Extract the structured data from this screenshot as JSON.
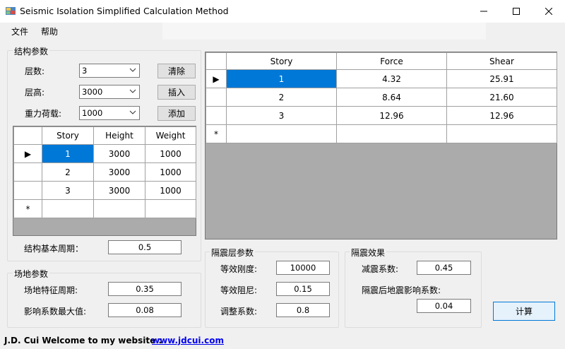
{
  "window": {
    "title": "Seismic Isolation Simplified Calculation Method",
    "controls": {
      "minimize": "—",
      "maximize": "☐",
      "close": "✕"
    }
  },
  "menu": {
    "file": "文件",
    "help": "帮助"
  },
  "structure": {
    "group_title": "结构参数",
    "floors_label": "层数:",
    "floors_value": "3",
    "height_label": "层高:",
    "height_value": "3000",
    "gravity_label": "重力荷载:",
    "gravity_value": "1000",
    "buttons": {
      "clear": "清除",
      "insert": "插入",
      "add": "添加"
    },
    "grid": {
      "headers": [
        "Story",
        "Height",
        "Weight"
      ],
      "rows": [
        [
          "1",
          "3000",
          "1000"
        ],
        [
          "2",
          "3000",
          "1000"
        ],
        [
          "3",
          "3000",
          "1000"
        ]
      ],
      "current_marker": "▶",
      "new_row_marker": "*"
    },
    "period_label": "结构基本周期：",
    "period_value": "0.5"
  },
  "site": {
    "group_title": "场地参数",
    "char_period_label": "场地特征周期:",
    "char_period_value": "0.35",
    "max_coef_label": "影响系数最大值:",
    "max_coef_value": "0.08"
  },
  "results_grid": {
    "headers": [
      "Story",
      "Force",
      "Shear"
    ],
    "rows": [
      [
        "1",
        "4.32",
        "25.91"
      ],
      [
        "2",
        "8.64",
        "21.60"
      ],
      [
        "3",
        "12.96",
        "12.96"
      ]
    ],
    "current_marker": "▶",
    "new_row_marker": "*"
  },
  "isolation_layer": {
    "group_title": "隔震层参数",
    "stiffness_label": "等效刚度:",
    "stiffness_value": "10000",
    "damping_label": "等效阻尼:",
    "damping_value": "0.15",
    "adjust_label": "调整系数:",
    "adjust_value": "0.8"
  },
  "isolation_effect": {
    "group_title": "隔震效果",
    "reduction_label": "减震系数:",
    "reduction_value": "0.45",
    "after_label": "隔震后地震影响系数:",
    "after_value": "0.04"
  },
  "calc_button": "计算",
  "status": {
    "text": "J.D. Cui  Welcome to my website :",
    "link": "www.jdcui.com"
  },
  "colors": {
    "selection": "#0078d7",
    "grid_empty": "#ababab",
    "link": "#0000ee"
  }
}
